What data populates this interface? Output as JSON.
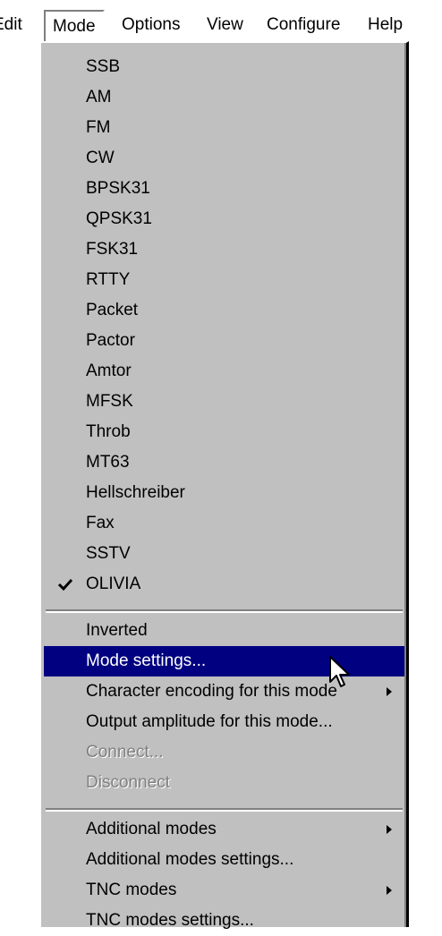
{
  "menubar": {
    "edit": "Edit",
    "mode": "Mode",
    "options": "Options",
    "view": "View",
    "configure": "Configure",
    "help": "Help"
  },
  "mode_menu": {
    "modes": [
      "SSB",
      "AM",
      "FM",
      "CW",
      "BPSK31",
      "QPSK31",
      "FSK31",
      "RTTY",
      "Packet",
      "Pactor",
      "Amtor",
      "MFSK",
      "Throb",
      "MT63",
      "Hellschreiber",
      "Fax",
      "SSTV",
      "OLIVIA"
    ],
    "checked_mode": "OLIVIA",
    "inverted": "Inverted",
    "mode_settings": "Mode settings...",
    "character_encoding": "Character encoding for this mode",
    "output_amplitude": "Output amplitude for this mode...",
    "connect": "Connect...",
    "disconnect": "Disconnect",
    "additional_modes": "Additional modes",
    "additional_modes_settings": "Additional modes settings...",
    "tnc_modes": "TNC modes",
    "tnc_modes_settings": "TNC modes settings..."
  }
}
